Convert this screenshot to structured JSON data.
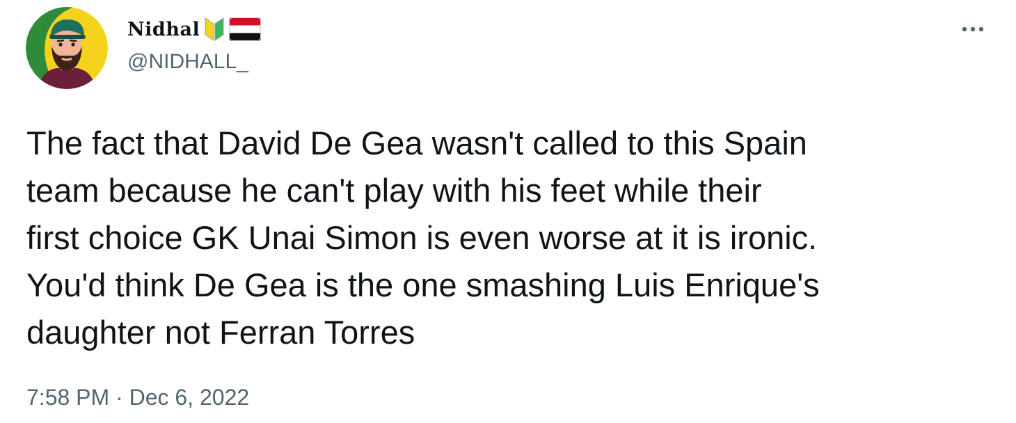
{
  "tweet": {
    "author": {
      "display_name": "Nidhal",
      "handle": "@NIDHALL_",
      "avatar_icon": "cartoon-avatar-icon",
      "name_emojis": [
        "beginner-badge-icon",
        "yemen-flag-icon"
      ]
    },
    "more_icon": "more-options-icon",
    "text_lines": [
      "The fact that David De Gea wasn't called to this Spain",
      "team because he can't play with his feet while their",
      "first choice GK Unai Simon is even worse at it is ironic.",
      "You'd think De Gea is the one smashing Luis Enrique's",
      "daughter not Ferran Torres"
    ],
    "time": "7:58 PM",
    "separator": " · ",
    "date": "Dec 6, 2022"
  },
  "colors": {
    "text_primary": "#0f1419",
    "text_secondary": "#536471",
    "background": "#ffffff",
    "avatar_ring_green": "#2e8b3a",
    "avatar_ring_yellow": "#f5d31c"
  }
}
